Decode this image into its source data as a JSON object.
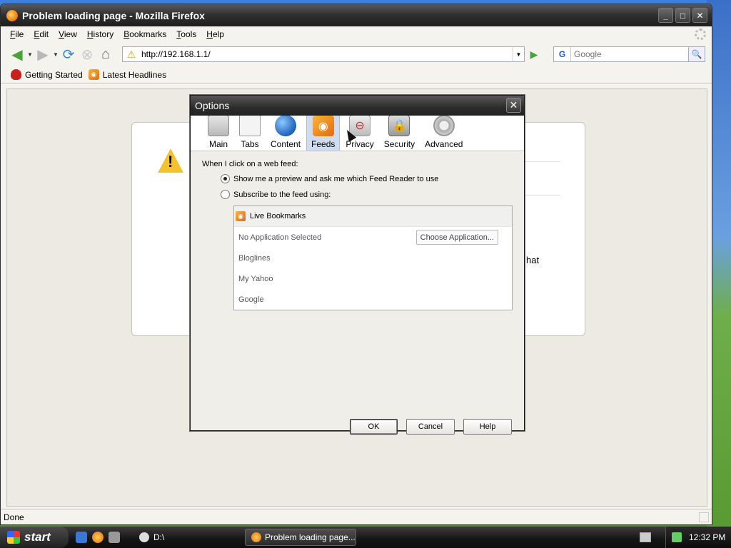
{
  "window": {
    "title": "Problem loading page - Mozilla Firefox",
    "minimize": "_",
    "maximize": "□",
    "close": "✕"
  },
  "menu": [
    {
      "label": "File",
      "accel": "F",
      "rest": "ile"
    },
    {
      "label": "Edit",
      "accel": "E",
      "rest": "dit"
    },
    {
      "label": "View",
      "accel": "V",
      "rest": "iew"
    },
    {
      "label": "History",
      "accel": "H",
      "rest": "istory"
    },
    {
      "label": "Bookmarks",
      "accel": "B",
      "rest": "ookmarks"
    },
    {
      "label": "Tools",
      "accel": "T",
      "rest": "ools"
    },
    {
      "label": "Help",
      "accel": "H",
      "rest": "elp"
    }
  ],
  "nav": {
    "url": "http://192.168.1.1/",
    "search_placeholder": "Google",
    "search_engine": "G"
  },
  "bookmarks": {
    "getting_started": "Getting Started",
    "latest_headlines": "Latest Headlines"
  },
  "page": {
    "fragment": "hat"
  },
  "status": {
    "text": "Done"
  },
  "dialog": {
    "title": "Options",
    "close": "✕",
    "tabs": [
      {
        "label": "Main",
        "icon": "main-icon"
      },
      {
        "label": "Tabs",
        "icon": "tabs-icon"
      },
      {
        "label": "Content",
        "icon": "content-icon"
      },
      {
        "label": "Feeds",
        "icon": "feeds-icon",
        "active": true
      },
      {
        "label": "Privacy",
        "icon": "privacy-icon"
      },
      {
        "label": "Security",
        "icon": "security-icon"
      },
      {
        "label": "Advanced",
        "icon": "advanced-icon"
      }
    ],
    "feeds": {
      "prompt": "When I click on a web feed:",
      "option_preview": "Show me a preview and ask me which Feed Reader to use",
      "option_subscribe": "Subscribe to the feed using:",
      "selected": "preview",
      "readers": {
        "header": "Live Bookmarks",
        "items": [
          "No Application Selected",
          "Bloglines",
          "My Yahoo",
          "Google"
        ],
        "choose_button": "Choose Application..."
      }
    },
    "buttons": {
      "ok": "OK",
      "cancel": "Cancel",
      "help": "Help"
    }
  },
  "taskbar": {
    "start": "start",
    "drive": "D:\\",
    "task": "Problem loading page...",
    "clock": "12:32 PM"
  },
  "colors": {
    "accent_tab": "#cfdcf0",
    "rss_orange": "#e2690f",
    "warning_yellow": "#f2c230"
  }
}
